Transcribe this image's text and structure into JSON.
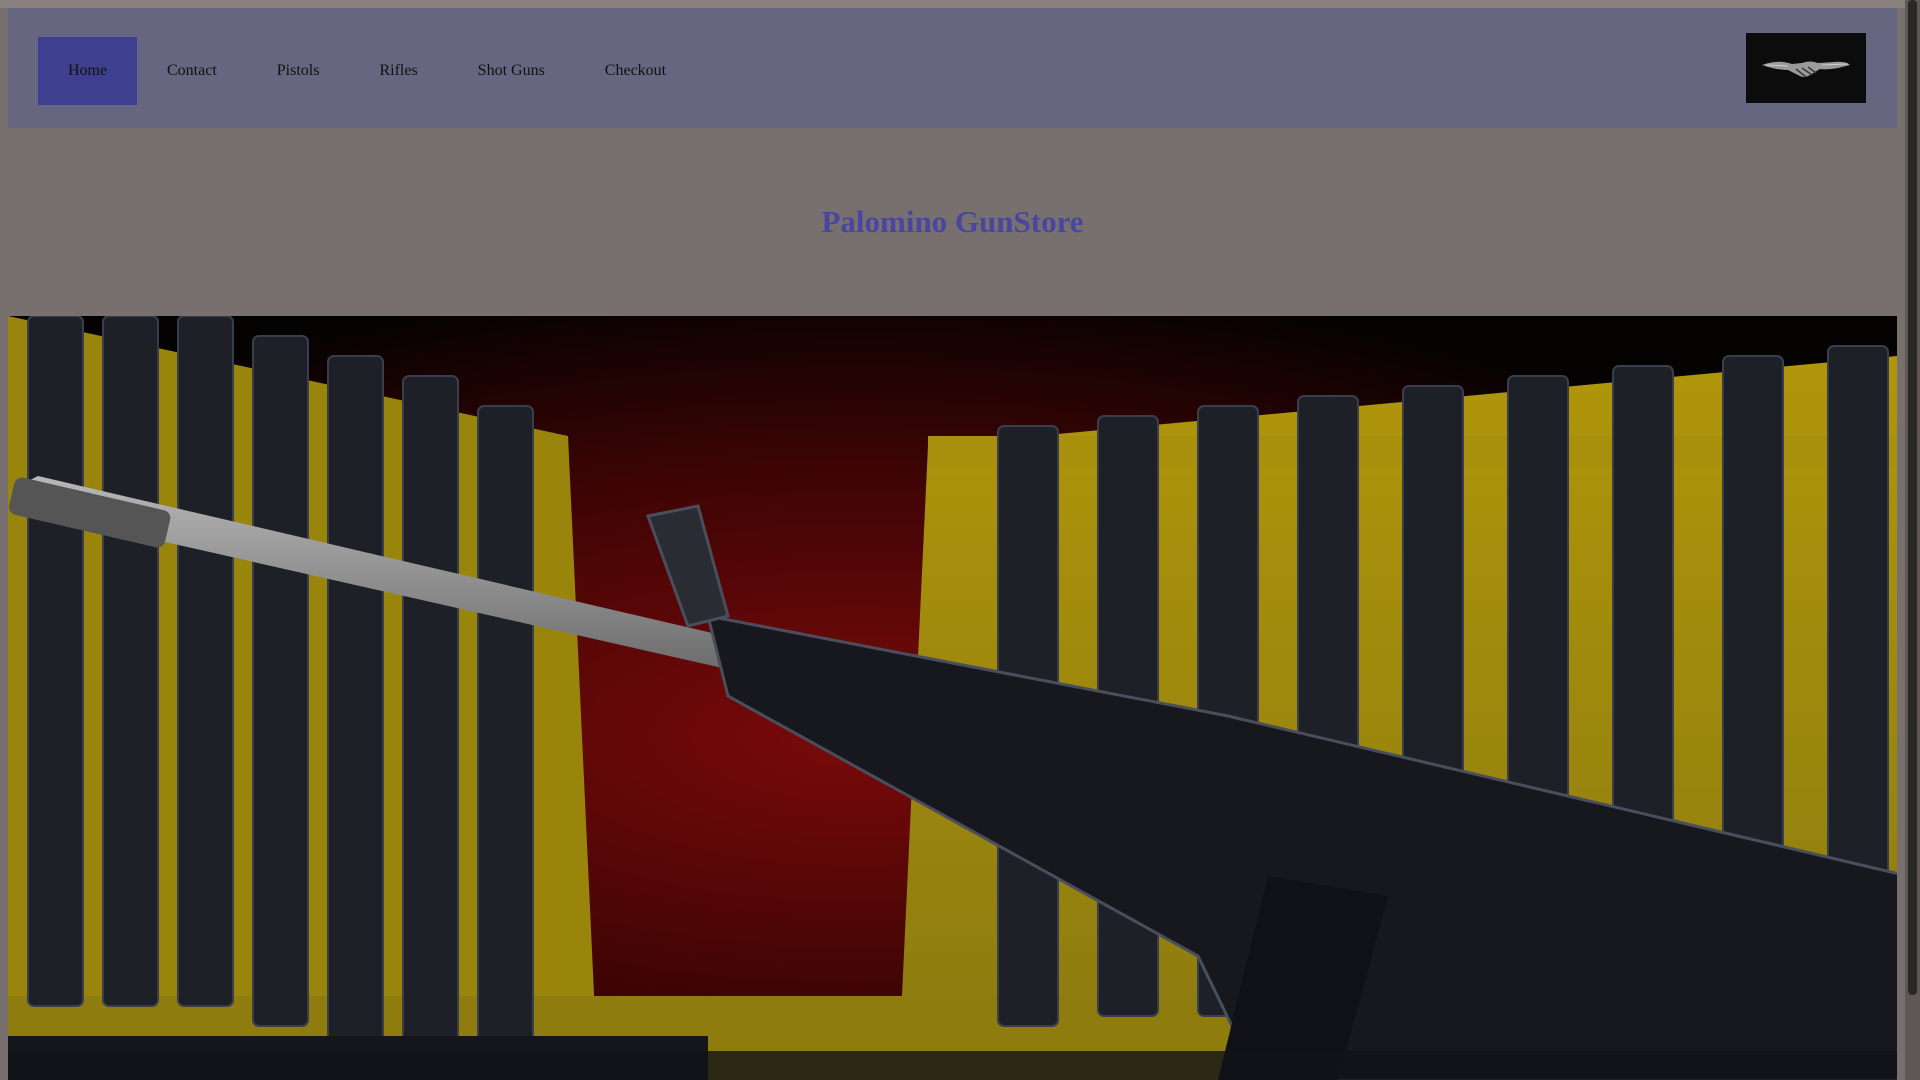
{
  "nav": {
    "items": [
      {
        "label": "Home",
        "active": true
      },
      {
        "label": "Contact",
        "active": false
      },
      {
        "label": "Pistols",
        "active": false
      },
      {
        "label": "Rifles",
        "active": false
      },
      {
        "label": "Shot Guns",
        "active": false
      },
      {
        "label": "Checkout",
        "active": false
      }
    ],
    "logo_icon": "handshake-icon"
  },
  "header": {
    "title": "Palomino GunStore"
  },
  "hero": {
    "image_subject": "rifle-rack"
  },
  "colors": {
    "nav_bg": "#666680",
    "nav_active": "#3f3f8f",
    "title": "#4846a0",
    "page_bg": "#77706f"
  }
}
